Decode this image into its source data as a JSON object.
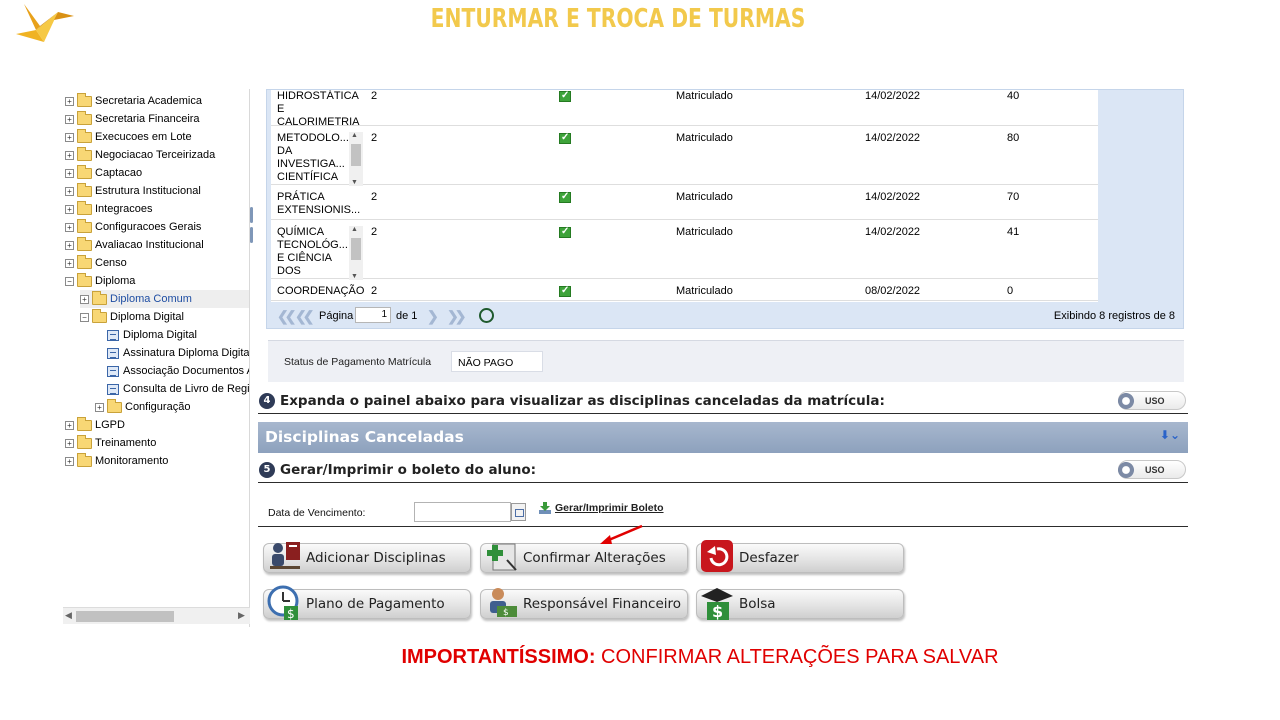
{
  "slide": {
    "title": "ENTURMAR E TROCA DE TURMAS",
    "footnote_strong": "IMPORTANTÍSSIMO:",
    "footnote_rest": " CONFIRMAR ALTERAÇÕES PARA SALVAR"
  },
  "tree": {
    "items": [
      {
        "label": "Secretaria Academica",
        "exp": "+"
      },
      {
        "label": "Secretaria Financeira",
        "exp": "+"
      },
      {
        "label": "Execucoes em Lote",
        "exp": "+"
      },
      {
        "label": "Negociacao Terceirizada",
        "exp": "+"
      },
      {
        "label": "Captacao",
        "exp": "+"
      },
      {
        "label": "Estrutura Institucional",
        "exp": "+"
      },
      {
        "label": "Integracoes",
        "exp": "+"
      },
      {
        "label": "Configuracoes Gerais",
        "exp": "+"
      },
      {
        "label": "Avaliacao Institucional",
        "exp": "+"
      },
      {
        "label": "Censo",
        "exp": "+"
      },
      {
        "label": "Diploma",
        "exp": "−"
      },
      {
        "label": "Diploma Comum",
        "exp": "+"
      },
      {
        "label": "Diploma Digital",
        "exp": "−"
      },
      {
        "label": "Diploma Digital"
      },
      {
        "label": "Assinatura Diploma Digital"
      },
      {
        "label": "Associação Documentos Al"
      },
      {
        "label": "Consulta de Livro de Regist"
      },
      {
        "label": "Configuração",
        "exp": "+"
      },
      {
        "label": "LGPD",
        "exp": "+"
      },
      {
        "label": "Treinamento",
        "exp": "+"
      },
      {
        "label": "Monitoramento",
        "exp": "+"
      }
    ]
  },
  "grid": {
    "rows": [
      {
        "name": "HIDROSTÁTICA E CALORIMETRIA",
        "name_lines": [
          "HIDROSTÁTICA",
          "E",
          "CALORIMETRIA"
        ],
        "credits": "2",
        "status": "Matriculado",
        "date": "14/02/2022",
        "value": "40"
      },
      {
        "name_lines": [
          "METODOLO...",
          "DA",
          "INVESTIGA...",
          "CIENTÍFICA"
        ],
        "credits": "2",
        "status": "Matriculado",
        "date": "14/02/2022",
        "value": "80"
      },
      {
        "name_lines": [
          "PRÁTICA",
          "EXTENSIONIS..."
        ],
        "credits": "2",
        "status": "Matriculado",
        "date": "14/02/2022",
        "value": "70"
      },
      {
        "name_lines": [
          "QUÍMICA",
          "TECNOLÓG...",
          "E CIÊNCIA",
          "DOS"
        ],
        "credits": "2",
        "status": "Matriculado",
        "date": "14/02/2022",
        "value": "41"
      },
      {
        "name_lines": [
          "COORDENAÇÃO"
        ],
        "credits": "2",
        "status": "Matriculado",
        "date": "08/02/2022",
        "value": "0"
      }
    ],
    "pager": {
      "page_label": "Página",
      "page_value": "1",
      "of_label": "de 1",
      "info": "Exibindo 8 registros de 8"
    }
  },
  "status_pagamento": {
    "label": "Status de Pagamento Matrícula",
    "value": "NÃO PAGO"
  },
  "sections": {
    "s4_num": "4",
    "s4_text": "Expanda o painel abaixo para visualizar as disciplinas canceladas da matrícula:",
    "panel_title": "Disciplinas Canceladas",
    "s5_num": "5",
    "s5_text": "Gerar/Imprimir o boleto do aluno:",
    "toggle_label": "USO"
  },
  "boleto": {
    "venc_label": "Data de Vencimento:",
    "venc_value": "",
    "link": "Gerar/Imprimir Boleto"
  },
  "buttons": {
    "add": "Adicionar Disciplinas",
    "confirm": "Confirmar Alterações",
    "undo": "Desfazer",
    "plan": "Plano de Pagamento",
    "resp": "Responsável Financeiro",
    "bolsa": "Bolsa"
  },
  "colors": {
    "title": "#f2c94c",
    "footnote": "#e00000",
    "panel": "#9aadc7",
    "grid_bg": "#dbe6f5"
  }
}
